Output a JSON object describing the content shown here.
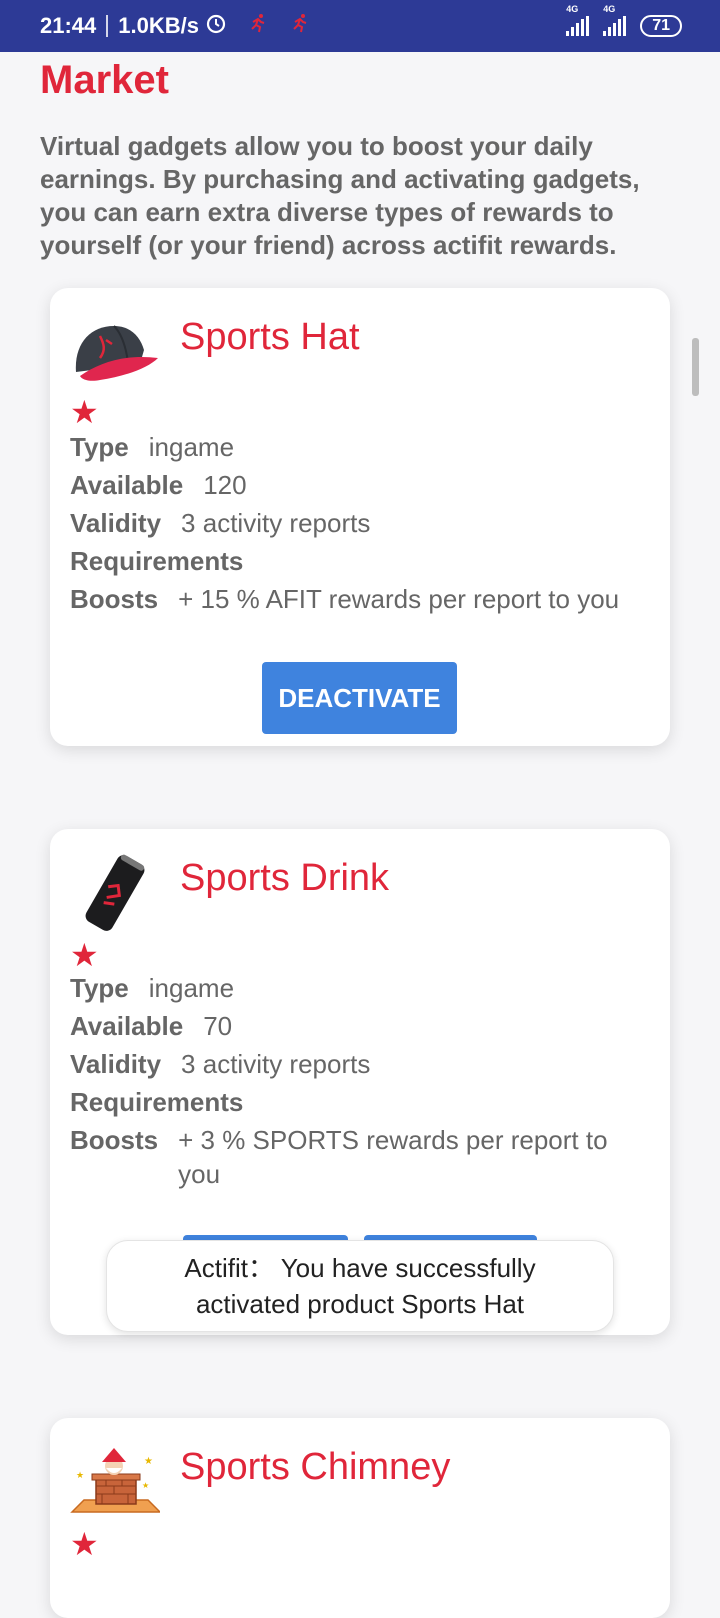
{
  "status_bar": {
    "time": "21:44",
    "speed": "1.0KB/s",
    "network_1": "4G",
    "network_2": "4G",
    "battery": "71",
    "icons": [
      "alarm-icon",
      "running-icon",
      "running-icon",
      "signal-icon",
      "signal-icon",
      "battery-icon"
    ]
  },
  "page": {
    "title": "Market",
    "intro": "Virtual gadgets allow you to boost your daily earnings. By purchasing and activating gadgets, you can earn extra diverse types of rewards to yourself (or your friend) across actifit rewards."
  },
  "labels": {
    "type": "Type",
    "available": "Available",
    "validity": "Validity",
    "requirements": "Requirements",
    "boosts": "Boosts"
  },
  "products": [
    {
      "name": "Sports Hat",
      "icon": "hat-icon",
      "type": "ingame",
      "available": "120",
      "validity": "3 activity reports",
      "requirements": "",
      "boosts": "+ 15 % AFIT rewards per report to you",
      "button": "DEACTIVATE"
    },
    {
      "name": "Sports Drink",
      "icon": "drink-can-icon",
      "type": "ingame",
      "available": "70",
      "validity": "3 activity reports",
      "requirements": "",
      "boosts": "+ 3 % SPORTS rewards per report to you"
    },
    {
      "name": "Sports Chimney",
      "icon": "chimney-icon"
    }
  ],
  "toast": {
    "message": "Actifit： You have successfully activated product Sports Hat"
  },
  "colors": {
    "accent": "#e0263a",
    "button": "#3f83de",
    "status_bar": "#2d3a96"
  }
}
